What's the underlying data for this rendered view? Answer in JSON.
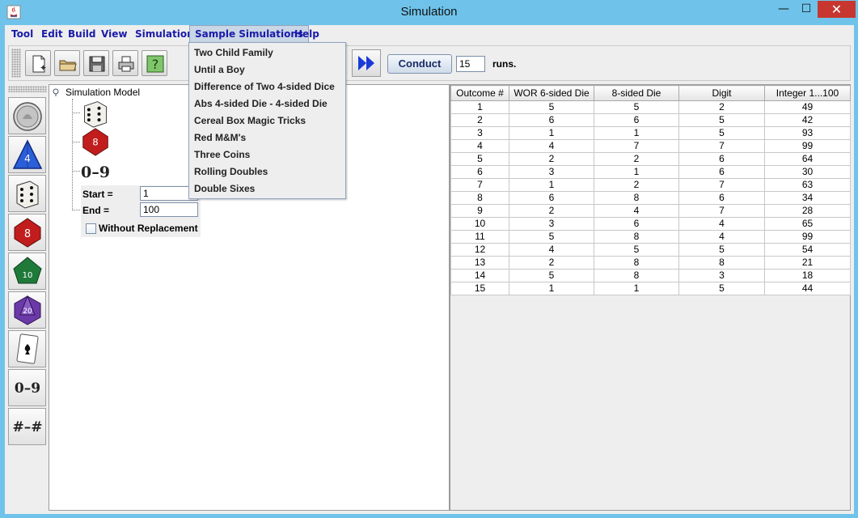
{
  "window": {
    "title": "Simulation",
    "close_glyph": "✕",
    "minimize_glyph": "—",
    "maximize_glyph": "☐"
  },
  "menu": {
    "items": [
      "Tool",
      "Edit",
      "Build",
      "View",
      "Simulation",
      "Sample Simulations",
      "Help"
    ],
    "active": "Sample Simulations",
    "accent_color": "#1a1aa8"
  },
  "sample_simulations": [
    "Two Child Family",
    "Until a Boy",
    "Difference of Two 4-sided Dice",
    "Abs 4-sided Die - 4-sided Die",
    "Cereal Box Magic Tricks",
    "Red M&M's",
    "Three Coins",
    "Rolling Doubles",
    "Double Sixes"
  ],
  "toolbar": {
    "buttons": [
      "new-document-icon",
      "open-folder-icon",
      "save-disk-icon",
      "print-icon",
      "help-question-icon"
    ],
    "fast_forward_icon": "fast-forward-icon",
    "conduct_label": "Conduct",
    "runs_value": "15",
    "runs_label": "runs."
  },
  "palette": {
    "tools": [
      "coin-icon",
      "four-sided-die-icon",
      "six-sided-die-icon",
      "eight-sided-die-icon",
      "ten-sided-die-icon",
      "twenty-sided-die-icon",
      "playing-card-icon",
      "digit-range-icon",
      "integer-range-icon"
    ],
    "d4_label": "4",
    "d8_label": "8",
    "d10_label": "10",
    "d20_label": "20",
    "digit_label": "0–9",
    "integer_label": "#–#"
  },
  "model": {
    "root_label": "Simulation Model",
    "nodes": [
      "six-sided-die-icon",
      "eight-sided-die-icon",
      "digit-range-icon"
    ],
    "d8_label": "8",
    "digit_label": "0–9",
    "start_label": "Start =",
    "start_value": "1",
    "end_label": "End =",
    "end_value": "100",
    "without_replacement_label": "Without Replacement",
    "without_replacement_checked": false
  },
  "results": {
    "headers": [
      "Outcome #",
      "WOR 6-sided Die",
      "8-sided Die",
      "Digit",
      "Integer 1...100"
    ],
    "rows": [
      [
        "1",
        "5",
        "5",
        "2",
        "49"
      ],
      [
        "2",
        "6",
        "6",
        "5",
        "42"
      ],
      [
        "3",
        "1",
        "1",
        "5",
        "93"
      ],
      [
        "4",
        "4",
        "7",
        "7",
        "99"
      ],
      [
        "5",
        "2",
        "2",
        "6",
        "64"
      ],
      [
        "6",
        "3",
        "1",
        "6",
        "30"
      ],
      [
        "7",
        "1",
        "2",
        "7",
        "63"
      ],
      [
        "8",
        "6",
        "8",
        "6",
        "34"
      ],
      [
        "9",
        "2",
        "4",
        "7",
        "28"
      ],
      [
        "10",
        "3",
        "6",
        "4",
        "65"
      ],
      [
        "11",
        "5",
        "8",
        "4",
        "99"
      ],
      [
        "12",
        "4",
        "5",
        "5",
        "54"
      ],
      [
        "13",
        "2",
        "8",
        "8",
        "21"
      ],
      [
        "14",
        "5",
        "8",
        "3",
        "18"
      ],
      [
        "15",
        "1",
        "1",
        "5",
        "44"
      ]
    ]
  }
}
